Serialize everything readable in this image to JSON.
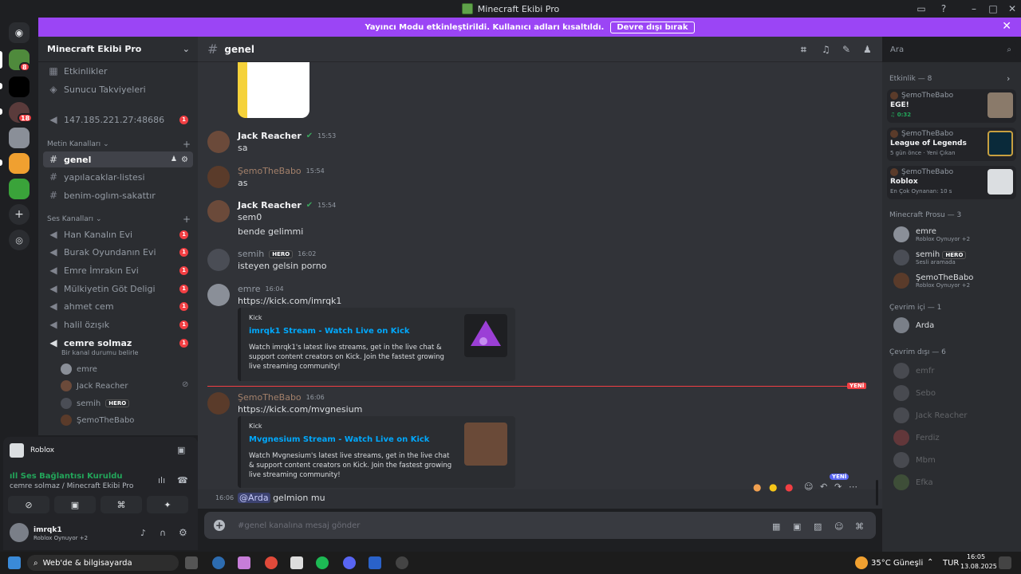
{
  "window": {
    "title": "Minecraft Ekibi Pro"
  },
  "banner": {
    "text": "Yayıncı Modu etkinleştirildi. Kullanıcı adları kısaltıldı.",
    "button": "Devre dışı bırak"
  },
  "rail": {
    "badges": [
      "8",
      "18"
    ]
  },
  "guild": {
    "name": "Minecraft Ekibi Pro"
  },
  "sidebar": {
    "top_items": [
      "Etkinlikler",
      "Sunucu Takviyeleri"
    ],
    "server_ip": "147.185.221.27:48686",
    "text_category": "Metin Kanalları",
    "text_channels": [
      "genel",
      "yapılacaklar-listesi",
      "benim-oglım-sakattır"
    ],
    "voice_category": "Ses Kanalları",
    "voice_channels": [
      "Han Kanalın Evi",
      "Burak Oyundanın Evi",
      "Emre İmrakın Evi",
      "Mülkiyetin Göt Deligi",
      "ahmet cem",
      "halil özışık",
      "cemre solmaz"
    ],
    "unread_badge": "1",
    "voice_status": "Bir kanal durumu belirle",
    "voice_users": [
      "emre",
      "Jack Reacher",
      "semih",
      "ŞemoTheBabo"
    ],
    "hero_tag": "HERO"
  },
  "panel": {
    "activity": "Roblox",
    "conn_status": "Ses Bağlantısı Kuruldu",
    "conn_channel": "cemre solmaz / Minecraft Ekibi Pro",
    "user_name": "imrqk1",
    "user_status": "Roblox Oynuyor",
    "user_status_more": "+2"
  },
  "chat": {
    "channel": "genel",
    "search_placeholder": "Ara",
    "messages": [
      {
        "author": "Jack Reacher",
        "time": "15:53",
        "lines": [
          "sa"
        ]
      },
      {
        "author": "ŞemoTheBabo",
        "time": "15:54",
        "lines": [
          "as"
        ]
      },
      {
        "author": "Jack Reacher",
        "time": "15:54",
        "lines": [
          "sem0",
          "bende gelimmi"
        ]
      },
      {
        "author": "semih",
        "time": "16:02",
        "lines": [
          "isteyen gelsin porno"
        ]
      },
      {
        "author": "emre",
        "time": "16:04",
        "link": "https://kick.com/imrqk1"
      },
      {
        "author": "ŞemoTheBabo",
        "time": "16:06",
        "link": "https://kick.com/mvgnesium"
      }
    ],
    "embeds": [
      {
        "provider": "Kick",
        "title": "imrqk1 Stream - Watch Live on Kick",
        "desc": "Watch imrqk1's latest live streams, get in the live chat & support content creators on Kick. Join the fastest growing live streaming community!"
      },
      {
        "provider": "Kick",
        "title": "Mvgnesium Stream - Watch Live on Kick",
        "desc": "Watch Mvgnesium's latest live streams, get in the live chat & support content creators on Kick. Join the fastest growing live streaming community!"
      }
    ],
    "new_label": "YENİ",
    "last_time": "16:06",
    "last_mention": "@Arda",
    "last_text": " gelmion mu",
    "composer_placeholder": "#genel kanalına mesaj gönder"
  },
  "members": {
    "activity_header": "Etkinlik — 8",
    "activities": [
      {
        "who": "ŞemoTheBabo",
        "game": "EGE!",
        "sub": "0:32"
      },
      {
        "who": "ŞemoTheBabo",
        "game": "League of Legends",
        "sub": "5 gün önce · Yeni Çıkan"
      },
      {
        "who": "ŞemoTheBabo",
        "game": "Roblox",
        "sub": "En Çok Oynanan: 10 s"
      }
    ],
    "role_header": "Minecraft Prosu — 3",
    "role_members": [
      {
        "name": "emre",
        "status": "Roblox Oynuyor +2"
      },
      {
        "name": "semih",
        "status": "Sesli aramada"
      },
      {
        "name": "ŞemoTheBabo",
        "status": "Roblox Oynuyor +2"
      }
    ],
    "online_header": "Çevrim içi — 1",
    "online": [
      "Arda"
    ],
    "offline_header": "Çevrim dışı — 6",
    "offline": [
      "emfr",
      "Sebo",
      "Jack Reacher",
      "Ferdiz",
      "Mbm",
      "Efka"
    ]
  },
  "taskbar": {
    "search": "Web'de & bilgisayarda",
    "weather": "35°C  Güneşli",
    "lang": "TUR",
    "time": "16:05",
    "date": "13.08.2025"
  }
}
